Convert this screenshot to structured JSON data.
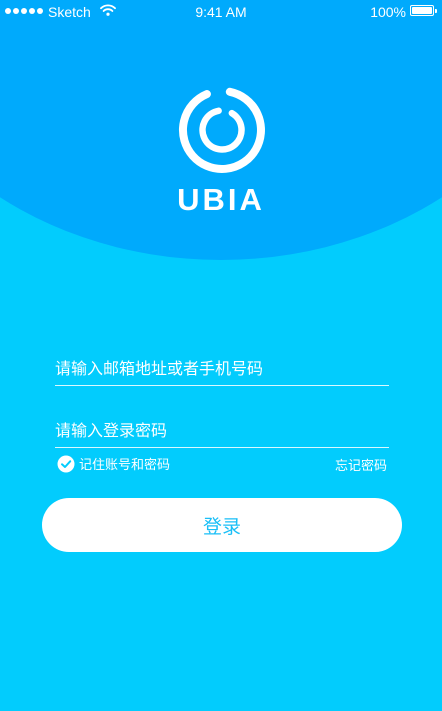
{
  "status_bar": {
    "carrier": "Sketch",
    "time": "9:41 AM",
    "battery_percent": "100%"
  },
  "icons": {
    "signal": "signal-dots-icon",
    "wifi": "wifi-icon",
    "battery": "battery-icon",
    "logo": "ubia-ring-logo-icon",
    "remember": "checkmark-circle-icon"
  },
  "brand": {
    "name": "UBIA"
  },
  "login_form": {
    "account": {
      "placeholder": "请输入邮箱地址或者手机号码",
      "value": ""
    },
    "password": {
      "placeholder": "请输入登录密码",
      "value": ""
    },
    "remember_label": "记住账号和密码",
    "remember_checked": true,
    "forgot_label": "忘记密码",
    "submit_label": "登录"
  },
  "colors": {
    "background": "#02CCFD",
    "header": "#00AAFC",
    "button_bg": "#FFFFFF",
    "button_text": "#19BFF7",
    "text": "#FFFFFF"
  }
}
